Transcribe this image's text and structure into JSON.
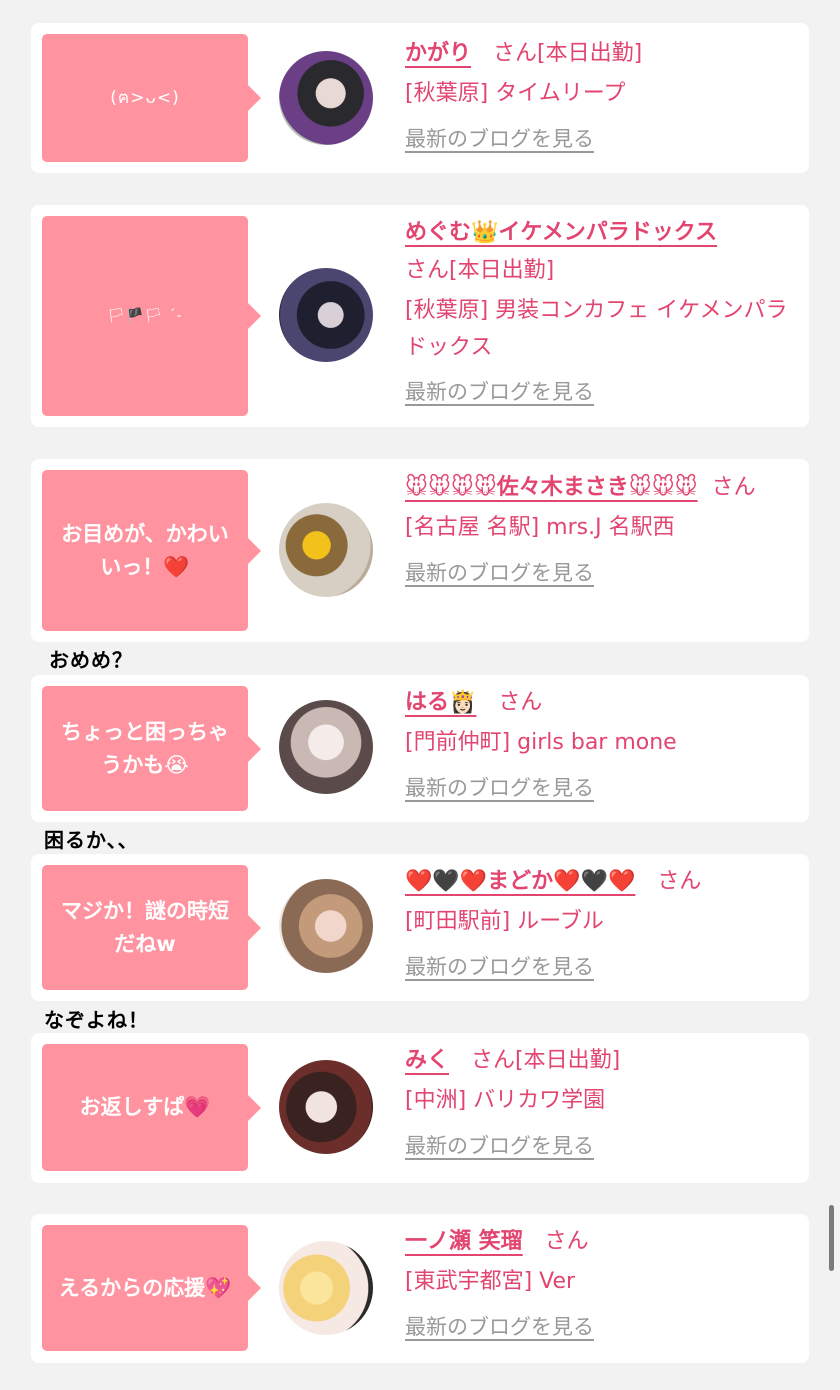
{
  "entries": [
    {
      "message": "(ฅ>ᴗ<)",
      "name": "かがり",
      "san": "さん",
      "status": "[本日出勤]",
      "shop": "[秋葉原] タイムリープ",
      "blog_link": "最新のブログを見る"
    },
    {
      "message": "🏳🏴🏳 ´-",
      "name": "めぐむ👑イケメンパラドックス",
      "san": "さん",
      "status": "[本日出勤]",
      "shop": "[秋葉原] 男装コンカフェ イケメンパラドックス",
      "blog_link": "最新のブログを見る"
    },
    {
      "message": "お目めが、かわいいっ！❤️",
      "name": "🐭🐭🐭🐭佐々木まさき🐭🐭🐭",
      "san": "さん",
      "shop": "[名古屋 名駅] mrs.J 名駅西",
      "blog_link": "最新のブログを見る",
      "reply": "おめめ？"
    },
    {
      "message": "ちょっと困っちゃうかも😭",
      "name": "はる👸🏻",
      "san": "さん",
      "shop": "[門前仲町] girls bar mone",
      "blog_link": "最新のブログを見る",
      "reply": "困るか、、"
    },
    {
      "message": "マジか！謎の時短だねw",
      "name": "❤️🖤❤️まどか❤️🖤❤️",
      "san": "さん",
      "shop": "[町田駅前] ルーブル",
      "blog_link": "最新のブログを見る",
      "reply": "なぞよね！"
    },
    {
      "message": "お返しすぱ💗",
      "name": "みく",
      "san": "さん",
      "status": "[本日出勤]",
      "shop": "[中洲] バリカワ学園",
      "blog_link": "最新のブログを見る"
    },
    {
      "message": "えるからの応援💖",
      "name": "一ノ瀬 笑瑠",
      "san": "さん",
      "shop": "[東武宇都宮] Ver",
      "blog_link": "最新のブログを見る"
    }
  ],
  "colors": {
    "accent": "#e2456f",
    "bubble": "#ff939f",
    "link_gray": "#999999",
    "background": "#f2f2f2"
  }
}
